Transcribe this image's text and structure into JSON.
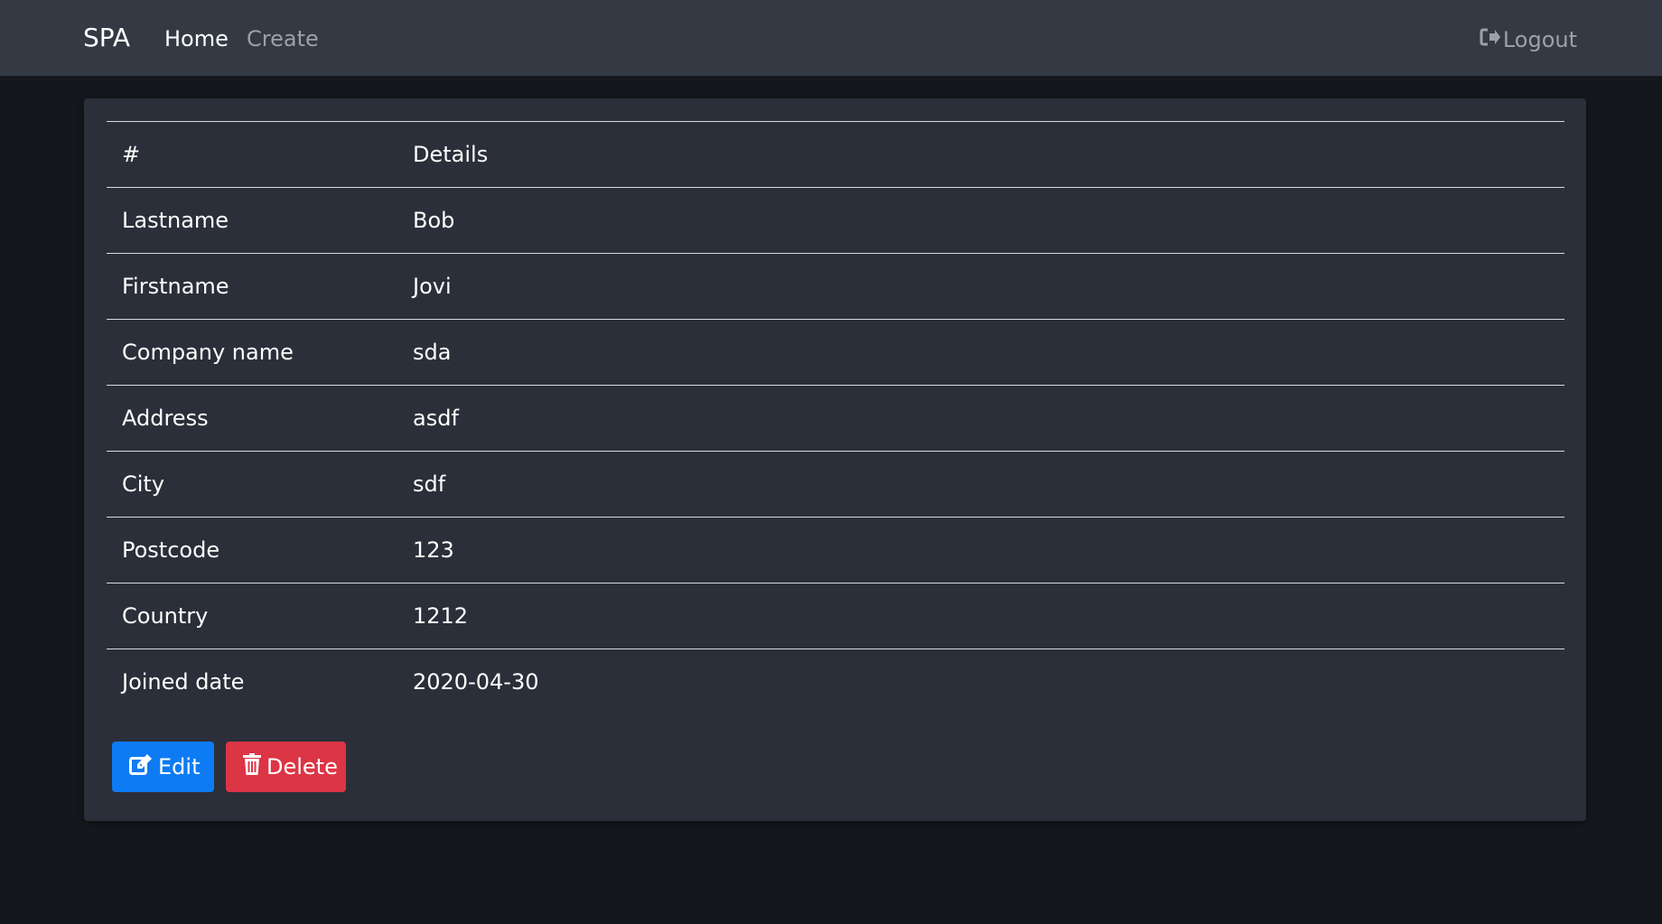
{
  "navbar": {
    "brand": "SPA",
    "links": [
      {
        "label": "Home",
        "active": true
      },
      {
        "label": "Create",
        "active": false
      }
    ],
    "logout_label": "Logout",
    "logout_icon": "sign-out-icon"
  },
  "details_table": {
    "header": {
      "col1": "#",
      "col2": "Details"
    },
    "rows": [
      {
        "label": "Lastname",
        "value": "Bob"
      },
      {
        "label": "Firstname",
        "value": "Jovi"
      },
      {
        "label": "Company name",
        "value": "sda"
      },
      {
        "label": "Address",
        "value": "asdf"
      },
      {
        "label": "City",
        "value": "sdf"
      },
      {
        "label": "Postcode",
        "value": "123"
      },
      {
        "label": "Country",
        "value": "1212"
      },
      {
        "label": "Joined date",
        "value": "2020-04-30"
      }
    ]
  },
  "actions": {
    "edit_label": "Edit",
    "edit_icon": "edit-icon",
    "delete_label": "Delete",
    "delete_icon": "trash-icon"
  },
  "colors": {
    "navbar_bg": "#343a43",
    "page_bg": "#14181d",
    "card_bg": "#2b2f39",
    "edit_button": "#0d7bf3",
    "delete_button": "#dc3546"
  }
}
